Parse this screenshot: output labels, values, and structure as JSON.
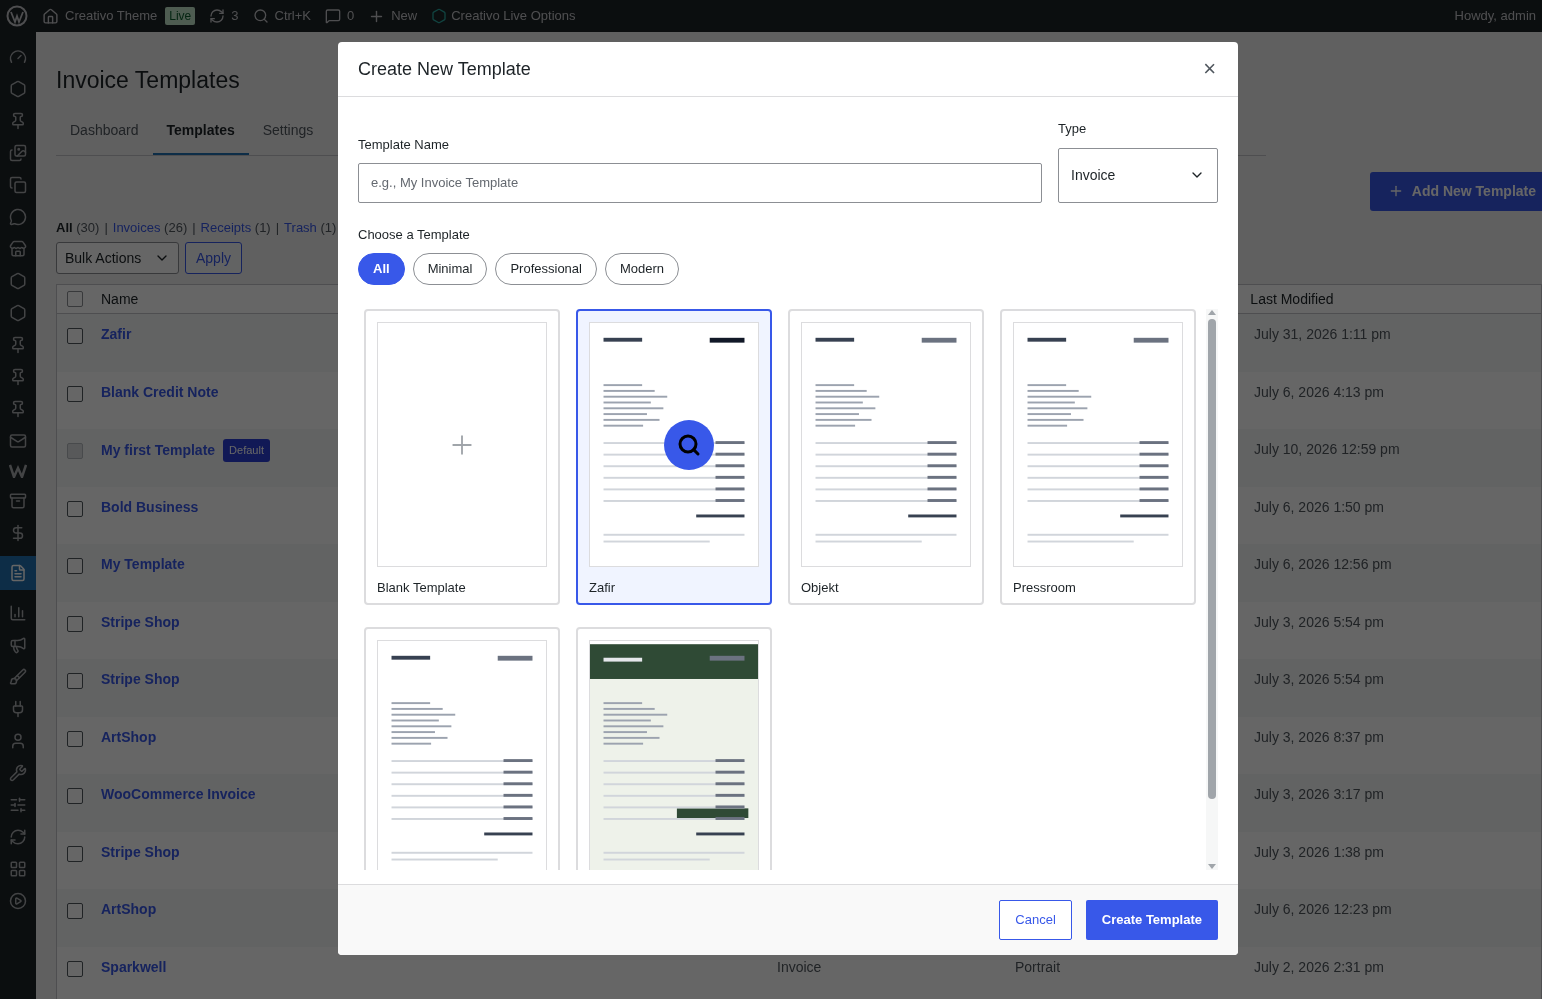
{
  "admin_bar": {
    "site": "Creativo Theme",
    "live_badge": "Live",
    "updates": "3",
    "search": "Ctrl+K",
    "comments": "0",
    "new": "New",
    "options": "Creativo Live Options",
    "greeting": "Howdy, admin"
  },
  "page": {
    "title": "Invoice Templates",
    "tabs": [
      {
        "label": "Dashboard",
        "selected": false
      },
      {
        "label": "Templates",
        "selected": true
      },
      {
        "label": "Settings",
        "selected": false
      }
    ],
    "add_button": "Add New Template",
    "filters": [
      {
        "label": "All",
        "count": "(30)",
        "selected": true
      },
      {
        "label": "Invoices",
        "count": "(26)",
        "selected": false
      },
      {
        "label": "Receipts",
        "count": "(1)",
        "selected": false
      },
      {
        "label": "Trash",
        "count": "(1)",
        "selected": false
      }
    ],
    "filter_separator": "|",
    "bulk_actions": "Bulk Actions",
    "apply": "Apply",
    "table": {
      "select_all_checked": false,
      "columns": [
        "Name",
        "Last Modified"
      ],
      "rows": [
        {
          "name": "Zafir",
          "modified": "July 31, 2026 1:11 pm",
          "disabled": false
        },
        {
          "name": "Blank Credit Note",
          "modified": "July 6, 2026 4:13 pm",
          "disabled": false
        },
        {
          "name": "My first Template",
          "badge": "Default",
          "modified": "July 10, 2026 12:59 pm",
          "disabled": true
        },
        {
          "name": "Bold Business",
          "modified": "July 6, 2026 1:50 pm",
          "disabled": false
        },
        {
          "name": "My Template",
          "modified": "July 6, 2026 12:56 pm",
          "disabled": false
        },
        {
          "name": "Stripe Shop",
          "modified": "July 3, 2026 5:54 pm",
          "disabled": false
        },
        {
          "name": "Stripe Shop",
          "modified": "July 3, 2026 5:54 pm",
          "disabled": false
        },
        {
          "name": "ArtShop",
          "modified": "July 3, 2026 8:37 pm",
          "disabled": false
        },
        {
          "name": "WooCommerce Invoice",
          "modified": "July 3, 2026 3:17 pm",
          "disabled": false
        },
        {
          "name": "Stripe Shop",
          "modified": "July 3, 2026 1:38 pm",
          "disabled": false
        },
        {
          "name": "ArtShop",
          "modified": "July 6, 2026 12:23 pm",
          "disabled": false
        },
        {
          "name": "Sparkwell",
          "column_2": "Invoice",
          "column_3": "Portrait",
          "modified": "July 2, 2026 2:31 pm",
          "disabled": false
        }
      ]
    }
  },
  "modal": {
    "title": "Create New Template",
    "close": "×",
    "name_label": "Template Name",
    "name_placeholder": "e.g., My Invoice Template",
    "type_label": "Type",
    "type_value": "Invoice",
    "choose_label": "Choose a Template",
    "categories": [
      {
        "label": "All",
        "selected": true
      },
      {
        "label": "Minimal",
        "selected": false
      },
      {
        "label": "Professional",
        "selected": false
      },
      {
        "label": "Modern",
        "selected": false
      }
    ],
    "templates": [
      {
        "label": "Blank Template",
        "kind": "blank",
        "selected": false,
        "hovered": false
      },
      {
        "label": "Zafir",
        "kind": "document",
        "selected": true,
        "hovered": true
      },
      {
        "label": "Objekt",
        "kind": "document",
        "selected": false,
        "hovered": false
      },
      {
        "label": "Pressroom",
        "kind": "document",
        "selected": false,
        "hovered": false
      },
      {
        "kind": "document",
        "selected": false,
        "hovered": false
      },
      {
        "kind": "dark",
        "selected": false,
        "hovered": false
      }
    ],
    "cancel": "Cancel",
    "create": "Create Template"
  }
}
